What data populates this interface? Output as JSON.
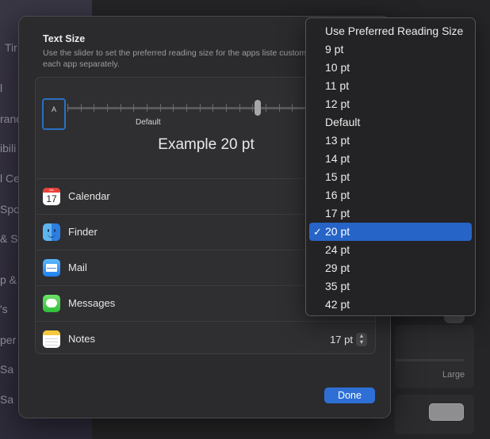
{
  "background": {
    "sidebar_fragments": [
      "Tir",
      "l",
      "ranc",
      "ibili",
      "l Ce",
      "Spot",
      "& S",
      "p &",
      "'s",
      "per",
      "Sa",
      "Sa"
    ],
    "large_label": "Large"
  },
  "sheet": {
    "title": "Text Size",
    "description": "Use the slider to set the preferred reading size for the apps liste customize each app separately.",
    "slider": {
      "start_label": "A",
      "default_label": "Default",
      "selected_value": "20 pt",
      "tick_count": 19
    },
    "example_text": "Example 20 pt",
    "apps": [
      {
        "name": "Calendar",
        "icon": "calendar-icon",
        "size": ""
      },
      {
        "name": "Finder",
        "icon": "finder-icon",
        "size": ""
      },
      {
        "name": "Mail",
        "icon": "mail-icon",
        "size": ""
      },
      {
        "name": "Messages",
        "icon": "messages-icon",
        "size": ""
      },
      {
        "name": "Notes",
        "icon": "notes-icon",
        "size": "17 pt"
      }
    ],
    "calendar_icon_month": "JUL",
    "calendar_icon_day": "17",
    "stepper_icon": "up-down-chevron-icon",
    "done_label": "Done"
  },
  "menu": {
    "items": [
      {
        "label": "Use Preferred Reading Size",
        "selected": false
      },
      {
        "label": "9 pt",
        "selected": false
      },
      {
        "label": "10 pt",
        "selected": false
      },
      {
        "label": "11 pt",
        "selected": false
      },
      {
        "label": "12 pt",
        "selected": false
      },
      {
        "label": "Default",
        "selected": false
      },
      {
        "label": "13 pt",
        "selected": false
      },
      {
        "label": "14 pt",
        "selected": false
      },
      {
        "label": "15 pt",
        "selected": false
      },
      {
        "label": "16 pt",
        "selected": false
      },
      {
        "label": "17 pt",
        "selected": false
      },
      {
        "label": "20 pt",
        "selected": true
      },
      {
        "label": "24 pt",
        "selected": false
      },
      {
        "label": "29 pt",
        "selected": false
      },
      {
        "label": "35 pt",
        "selected": false
      },
      {
        "label": "42 pt",
        "selected": false
      }
    ],
    "check_mark": "✓"
  },
  "colors": {
    "accent": "#2764c7",
    "done_button": "#2e6fd6"
  }
}
